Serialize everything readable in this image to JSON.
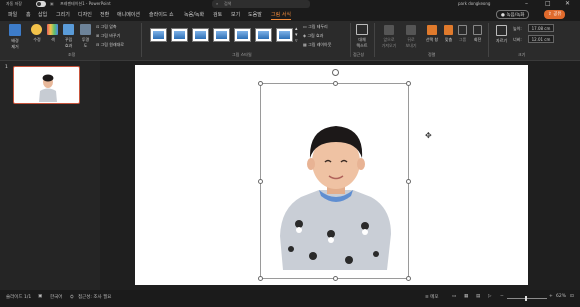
{
  "titlebar": {
    "autosave": "자동 저장",
    "filename": "프레젠테이션1 - PowerPoint",
    "search_placeholder": "검색",
    "user": "park dongkeong"
  },
  "tabs": [
    {
      "label": "파일"
    },
    {
      "label": "홈"
    },
    {
      "label": "삽입"
    },
    {
      "label": "그리기"
    },
    {
      "label": "디자인"
    },
    {
      "label": "전환"
    },
    {
      "label": "애니메이션"
    },
    {
      "label": "슬라이드 쇼"
    },
    {
      "label": "녹음/녹화"
    },
    {
      "label": "검토"
    },
    {
      "label": "보기"
    },
    {
      "label": "도움말"
    },
    {
      "label": "그림 서식"
    }
  ],
  "actions": {
    "record": "녹음/녹화",
    "share": "공유"
  },
  "ribbon": {
    "adjust": {
      "remove_bg": "배경\n제거",
      "corrections": "수정",
      "color": "색",
      "artistic": "꾸밈\n효과",
      "transparency": "투명\n도",
      "compress": "그림 압축",
      "change": "그림 바꾸기",
      "reset": "그림 원래대로",
      "group_label": "조정"
    },
    "styles": {
      "border": "그림 테두리",
      "effects": "그림 효과",
      "layout": "그림 레이아웃",
      "group_label": "그림 스타일"
    },
    "accessibility": {
      "alt_text": "대체\n텍스트",
      "group_label": "접근성"
    },
    "arrange": {
      "forward": "앞으로\n가져오기",
      "backward": "뒤로\n보내기",
      "selection_pane": "선택 창",
      "align": "맞춤",
      "group": "그룹",
      "rotate": "회전",
      "group_label": "정렬"
    },
    "size": {
      "crop": "자르기",
      "height_label": "높이:",
      "height": "17.08 cm",
      "width_label": "너비:",
      "width": "12.01 cm",
      "group_label": "크기"
    }
  },
  "slides": [
    {
      "number": "1"
    }
  ],
  "statusbar": {
    "slide_info": "슬라이드 1/1",
    "language": "한국어",
    "accessibility": "접근성: 조사 필요",
    "notes": "메모",
    "zoom": "62%"
  }
}
